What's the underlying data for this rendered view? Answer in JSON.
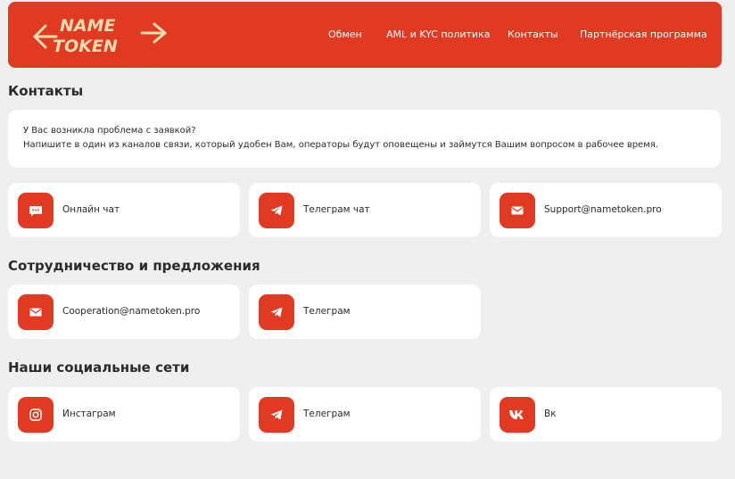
{
  "header": {
    "logo_line1": "NAME",
    "logo_line2": "TOKEN",
    "nav": [
      "Обмен",
      "AML и KYC политика",
      "Контакты",
      "Партнёрская программа"
    ]
  },
  "contacts": {
    "title": "Контакты",
    "intro_line1": "У Вас возникла проблема с заявкой?",
    "intro_line2": "Напишите в один из каналов связи, который удобен Вам, операторы будут оповещены и займутся Вашим вопросом в рабочее время.",
    "cards": [
      {
        "label": "Онлайн чат",
        "icon": "chat-icon"
      },
      {
        "label": "Телеграм чат",
        "icon": "telegram-icon"
      },
      {
        "label": "Support@nametoken.pro",
        "icon": "mail-icon"
      }
    ]
  },
  "cooperation": {
    "title": "Сотрудничество и предложения",
    "cards": [
      {
        "label": "Cooperation@nametoken.pro",
        "icon": "mail-icon"
      },
      {
        "label": "Телеграм",
        "icon": "telegram-icon"
      }
    ]
  },
  "social": {
    "title": "Наши социальные сети",
    "cards": [
      {
        "label": "Инстаграм",
        "icon": "instagram-icon"
      },
      {
        "label": "Телеграм",
        "icon": "telegram-icon"
      },
      {
        "label": "Вк",
        "icon": "vk-icon"
      }
    ]
  },
  "colors": {
    "accent": "#e03a22",
    "logo": "#f4dcae",
    "background": "#efefef",
    "card": "#ffffff"
  }
}
